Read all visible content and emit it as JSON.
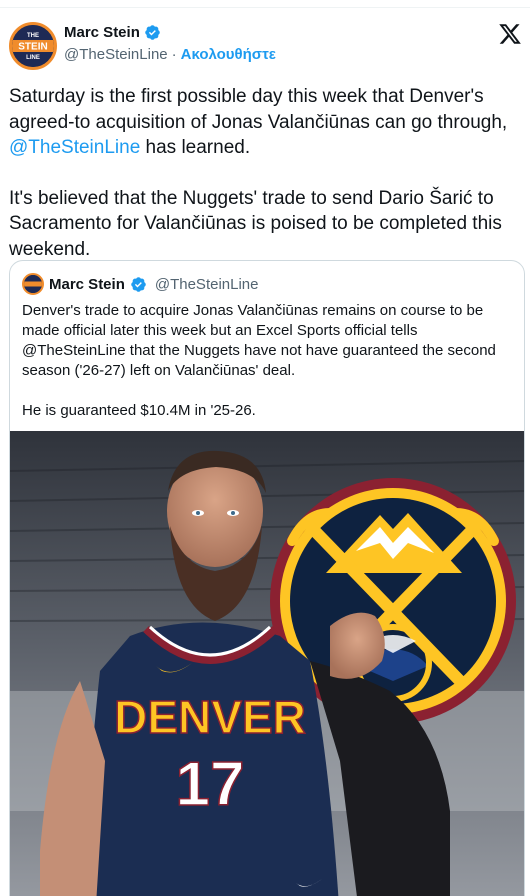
{
  "author": {
    "name": "Marc Stein",
    "handle": "@TheSteinLine",
    "separator": "·",
    "follow_label": "Ακολουθήστε",
    "avatar_text_top": "THE",
    "avatar_text_mid": "STEIN",
    "avatar_text_bottom": "LINE"
  },
  "tweet": {
    "paragraph1_a": "Saturday is the first possible day this week that Denver's agreed-to acquisition of Jonas Valančiūnas can go through, ",
    "paragraph1_mention": "@TheSteinLine",
    "paragraph1_b": " has learned.",
    "paragraph2": "It's believed that the Nuggets' trade to send Dario Šarić to Sacramento for Valančiūnas is poised to be completed this weekend."
  },
  "quoted_tweet": {
    "name": "Marc Stein",
    "handle": "@TheSteinLine",
    "paragraph1": "Denver's trade to acquire Jonas Valančiūnas remains on course to be made official later this week but an Excel Sports official tells @TheSteinLine that the Nuggets have not have guaranteed the second season ('26-27) left on Valančiūnas' deal.",
    "paragraph2": "He is guaranteed $10.4M in '25-26."
  },
  "media": {
    "jersey_text": "DENVER",
    "jersey_number": "17"
  },
  "colors": {
    "link": "#1d9bf0",
    "muted": "#536471",
    "nuggets_navy": "#0e2240",
    "nuggets_gold": "#fec524",
    "nuggets_red": "#8b2131",
    "nuggets_blue": "#1d428a"
  },
  "icons": [
    "verified-badge-icon",
    "x-logo-icon"
  ]
}
